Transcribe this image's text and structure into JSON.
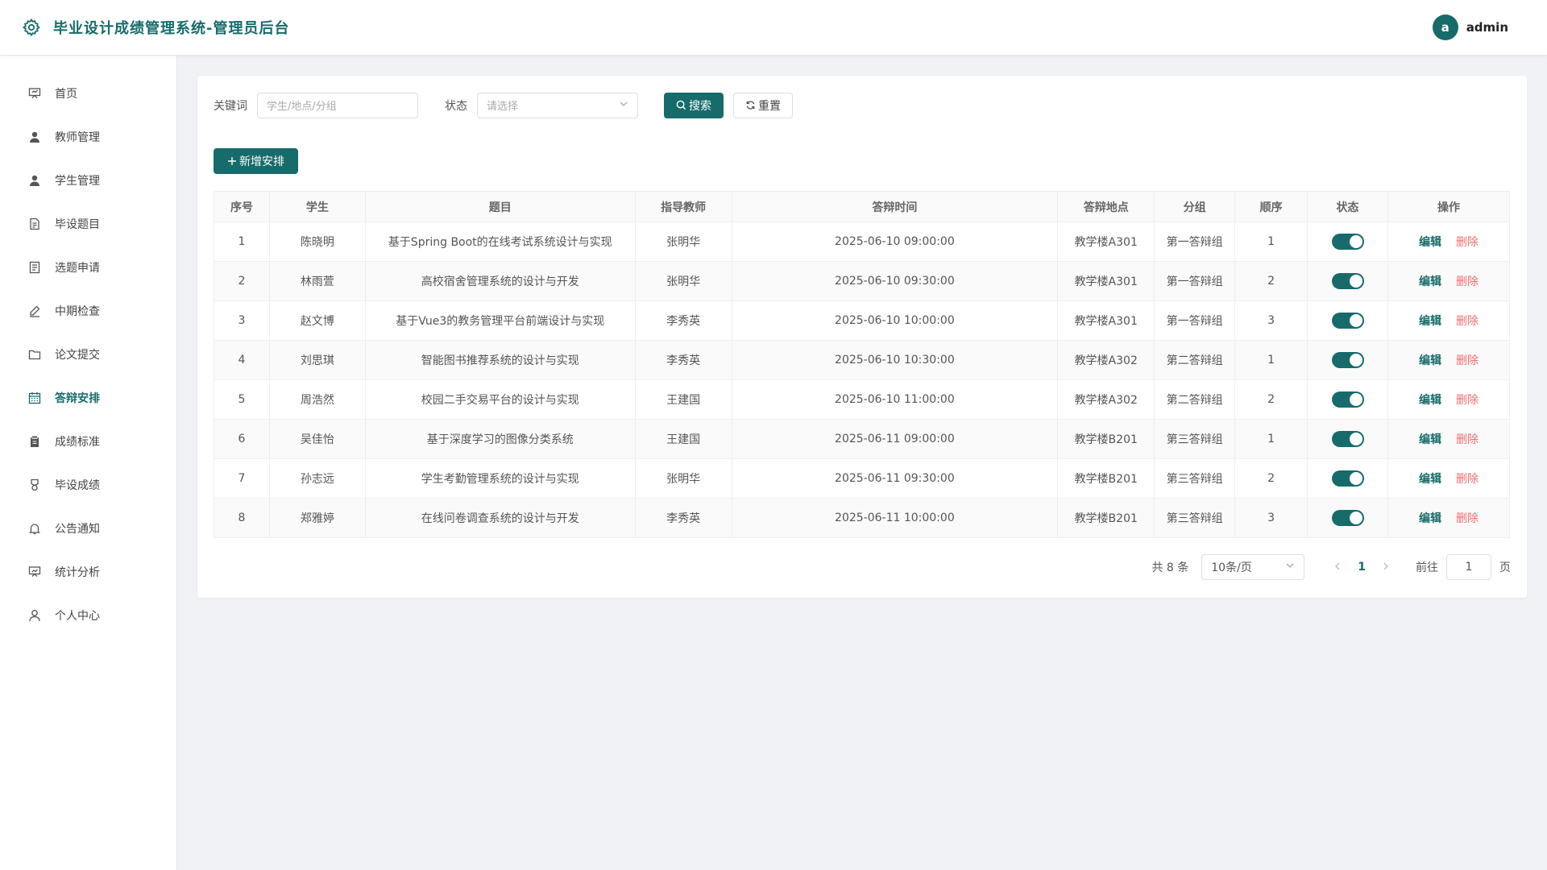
{
  "header": {
    "title": "毕业设计成绩管理系统-管理员后台",
    "user_avatar": "a",
    "username": "admin"
  },
  "sidebar": {
    "items": [
      {
        "label": "首页",
        "icon": "presentation-icon",
        "active": false
      },
      {
        "label": "教师管理",
        "icon": "user-icon",
        "active": false
      },
      {
        "label": "学生管理",
        "icon": "user-icon",
        "active": false
      },
      {
        "label": "毕设题目",
        "icon": "document-icon",
        "active": false
      },
      {
        "label": "选题申请",
        "icon": "document-list-icon",
        "active": false
      },
      {
        "label": "中期检查",
        "icon": "edit-pen-icon",
        "active": false
      },
      {
        "label": "论文提交",
        "icon": "folder-icon",
        "active": false
      },
      {
        "label": "答辩安排",
        "icon": "calendar-icon",
        "active": true
      },
      {
        "label": "成绩标准",
        "icon": "clipboard-icon",
        "active": false
      },
      {
        "label": "毕设成绩",
        "icon": "medal-icon",
        "active": false
      },
      {
        "label": "公告通知",
        "icon": "bell-icon",
        "active": false
      },
      {
        "label": "统计分析",
        "icon": "chart-board-icon",
        "active": false
      },
      {
        "label": "个人中心",
        "icon": "person-outline-icon",
        "active": false
      }
    ]
  },
  "filters": {
    "keyword_label": "关键词",
    "keyword_placeholder": "学生/地点/分组",
    "status_label": "状态",
    "status_placeholder": "请选择",
    "search_label": "搜索",
    "reset_label": "重置"
  },
  "actions": {
    "add_label": "新增安排"
  },
  "table": {
    "columns": [
      "序号",
      "学生",
      "题目",
      "指导教师",
      "答辩时间",
      "答辩地点",
      "分组",
      "顺序",
      "状态",
      "操作"
    ],
    "edit_label": "编辑",
    "delete_label": "删除",
    "rows": [
      {
        "no": "1",
        "student": "陈晓明",
        "topic": "基于Spring Boot的在线考试系统设计与实现",
        "teacher": "张明华",
        "time": "2025-06-10 09:00:00",
        "place": "教学楼A301",
        "group": "第一答辩组",
        "order": "1",
        "enabled": true
      },
      {
        "no": "2",
        "student": "林雨萱",
        "topic": "高校宿舍管理系统的设计与开发",
        "teacher": "张明华",
        "time": "2025-06-10 09:30:00",
        "place": "教学楼A301",
        "group": "第一答辩组",
        "order": "2",
        "enabled": true
      },
      {
        "no": "3",
        "student": "赵文博",
        "topic": "基于Vue3的教务管理平台前端设计与实现",
        "teacher": "李秀英",
        "time": "2025-06-10 10:00:00",
        "place": "教学楼A301",
        "group": "第一答辩组",
        "order": "3",
        "enabled": true
      },
      {
        "no": "4",
        "student": "刘思琪",
        "topic": "智能图书推荐系统的设计与实现",
        "teacher": "李秀英",
        "time": "2025-06-10 10:30:00",
        "place": "教学楼A302",
        "group": "第二答辩组",
        "order": "1",
        "enabled": true
      },
      {
        "no": "5",
        "student": "周浩然",
        "topic": "校园二手交易平台的设计与实现",
        "teacher": "王建国",
        "time": "2025-06-10 11:00:00",
        "place": "教学楼A302",
        "group": "第二答辩组",
        "order": "2",
        "enabled": true
      },
      {
        "no": "6",
        "student": "吴佳怡",
        "topic": "基于深度学习的图像分类系统",
        "teacher": "王建国",
        "time": "2025-06-11 09:00:00",
        "place": "教学楼B201",
        "group": "第三答辩组",
        "order": "1",
        "enabled": true
      },
      {
        "no": "7",
        "student": "孙志远",
        "topic": "学生考勤管理系统的设计与实现",
        "teacher": "张明华",
        "time": "2025-06-11 09:30:00",
        "place": "教学楼B201",
        "group": "第三答辩组",
        "order": "2",
        "enabled": true
      },
      {
        "no": "8",
        "student": "郑雅婷",
        "topic": "在线问卷调查系统的设计与开发",
        "teacher": "李秀英",
        "time": "2025-06-11 10:00:00",
        "place": "教学楼B201",
        "group": "第三答辩组",
        "order": "3",
        "enabled": true
      }
    ]
  },
  "pagination": {
    "total_text": "共 8 条",
    "page_size": "10条/页",
    "current_page": "1",
    "goto_label": "前往",
    "goto_value": "1",
    "page_suffix": "页"
  },
  "colors": {
    "primary": "#176b6b",
    "danger": "#f56c6c"
  }
}
